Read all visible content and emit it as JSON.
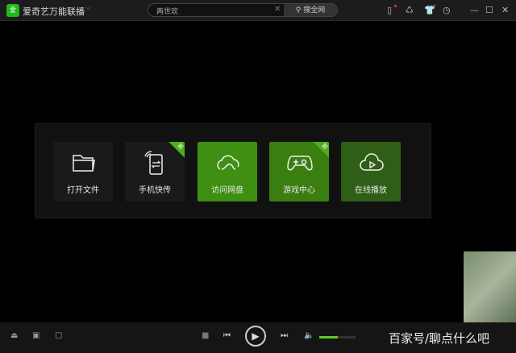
{
  "titlebar": {
    "logo_text": "爱",
    "app_name": "爱奇艺万能联播",
    "search_value": "两世欢",
    "search_button": "搜全网"
  },
  "tiles": [
    {
      "label": "打开文件",
      "icon": "folder-icon",
      "bg": "#1a1a1a",
      "new": false
    },
    {
      "label": "手机快传",
      "icon": "phone-transfer-icon",
      "bg": "#1a1a1a",
      "new": true
    },
    {
      "label": "访问网盘",
      "icon": "cloud-icon",
      "bg": "#3f8f12",
      "new": false
    },
    {
      "label": "游戏中心",
      "icon": "gamepad-icon",
      "bg": "#3a7d10",
      "new": true
    },
    {
      "label": "在线播放",
      "icon": "cloud-play-icon",
      "bg": "#2f5e17",
      "new": false
    }
  ],
  "new_badge": "新",
  "player": {
    "volume_percent": 50
  },
  "watermark": "百家号/聊点什么吧",
  "colors": {
    "accent": "#5fc828",
    "brand": "#1db91d"
  }
}
